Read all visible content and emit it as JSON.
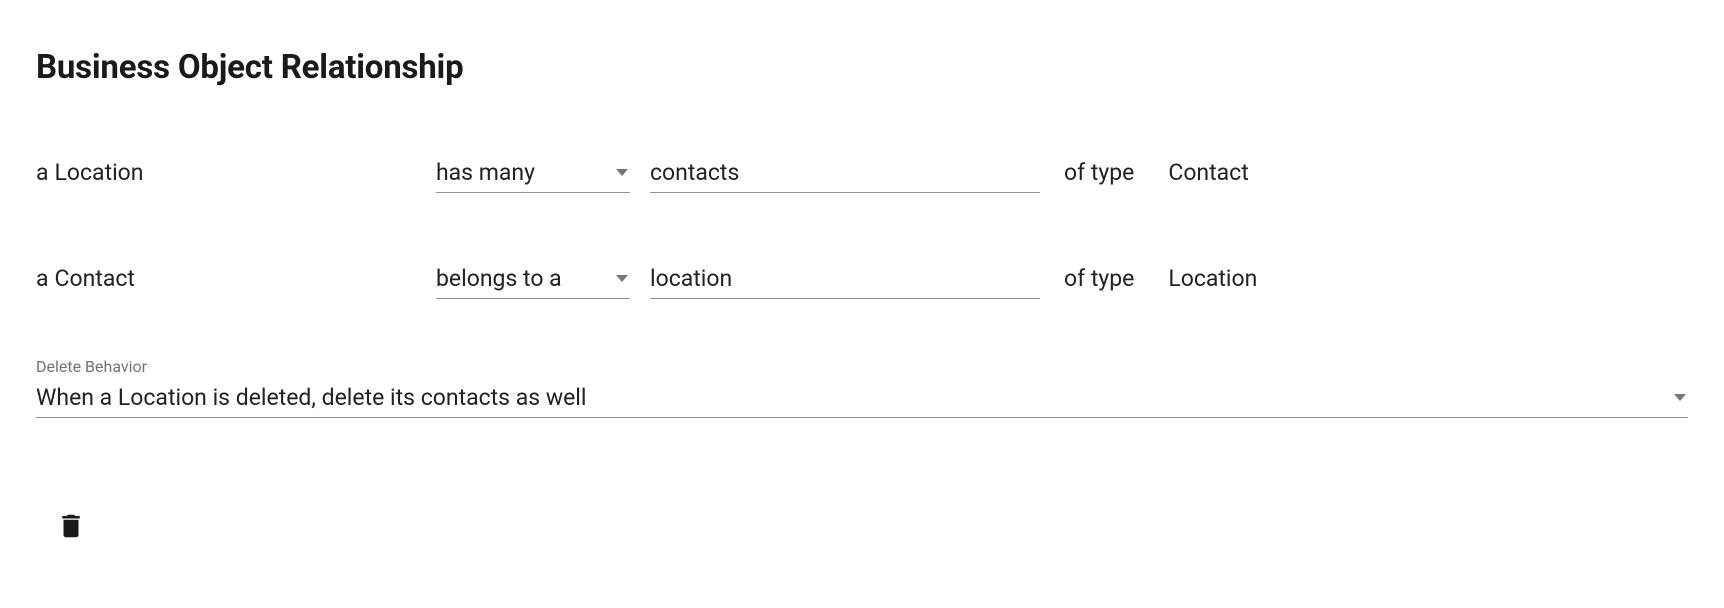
{
  "title": "Business Object Relationship",
  "row1": {
    "prefix": "a",
    "entity": "Location",
    "relation": "has many",
    "fieldValue": "contacts",
    "ofTypeLabel": "of type",
    "typeName": "Contact"
  },
  "row2": {
    "prefix": "a",
    "entity": "Contact",
    "relation": "belongs to a",
    "fieldValue": "location",
    "ofTypeLabel": "of type",
    "typeName": "Location"
  },
  "deleteBehavior": {
    "label": "Delete Behavior",
    "value": "When a Location is deleted, delete its contacts as well"
  }
}
